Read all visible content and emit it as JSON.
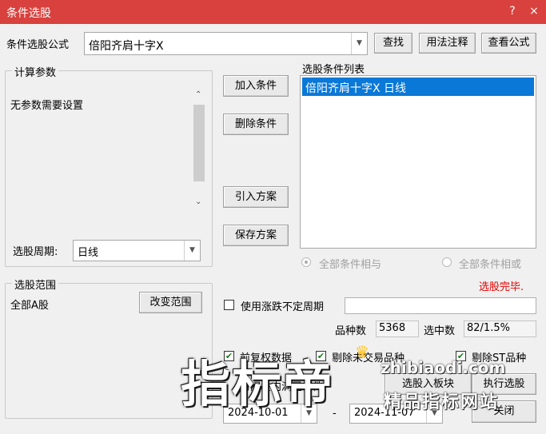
{
  "window": {
    "title": "条件选股",
    "help_glyph": "?",
    "close_glyph": "×"
  },
  "formula": {
    "label": "条件选股公式",
    "value": "倍阳齐肩十字X",
    "find_button": "查找",
    "usage_button": "用法注释",
    "view_button": "查看公式"
  },
  "params": {
    "group_title": "计算参数",
    "text": "无参数需要设置",
    "period_label": "选股周期:",
    "period_value": "日线"
  },
  "actions": {
    "add": "加入条件",
    "delete": "删除条件",
    "import": "引入方案",
    "save": "保存方案"
  },
  "conditions": {
    "title": "选股条件列表",
    "items": [
      "倍阳齐肩十字X  日线"
    ]
  },
  "logic": {
    "and_label": "全部条件相与",
    "or_label": "全部条件相或",
    "selected": "and"
  },
  "status": {
    "text": "选股完毕."
  },
  "scope": {
    "group_title": "选股范围",
    "value": "全部A股",
    "change_button": "改变范围"
  },
  "variable_period": {
    "label": "使用涨跌不定周期",
    "checked": false
  },
  "counts": {
    "total_label": "品种数",
    "total_value": "5368",
    "selected_label": "选中数",
    "selected_value": "82/1.5%"
  },
  "filters": {
    "prior_data_label": "前复权数据",
    "prior_data_checked": true,
    "exclude_suspended_label": "剔除未交易品种",
    "exclude_suspended_checked": true,
    "exclude_st_label": "剔除ST品种",
    "exclude_st_checked": true
  },
  "time": {
    "label": "时间段内满足条件",
    "start": "2024-10-01",
    "separator": "-",
    "end": "2024-11-07"
  },
  "bottom_buttons": {
    "to_block": "选股入板块",
    "execute": "执行选股",
    "close": "关闭"
  },
  "watermark": {
    "big": "指标帝",
    "url": "zhibiaodi.com",
    "sub": "精品指标网站"
  },
  "icons": {
    "combo_arrow": "chevron-down-icon",
    "scroll_up": "chevron-up-icon",
    "scroll_down": "chevron-down-icon",
    "check": "check-icon",
    "crown": "crown-icon"
  },
  "colors": {
    "titlebar": "#d8413d",
    "selection": "#0a78d7",
    "status": "#e20000"
  }
}
